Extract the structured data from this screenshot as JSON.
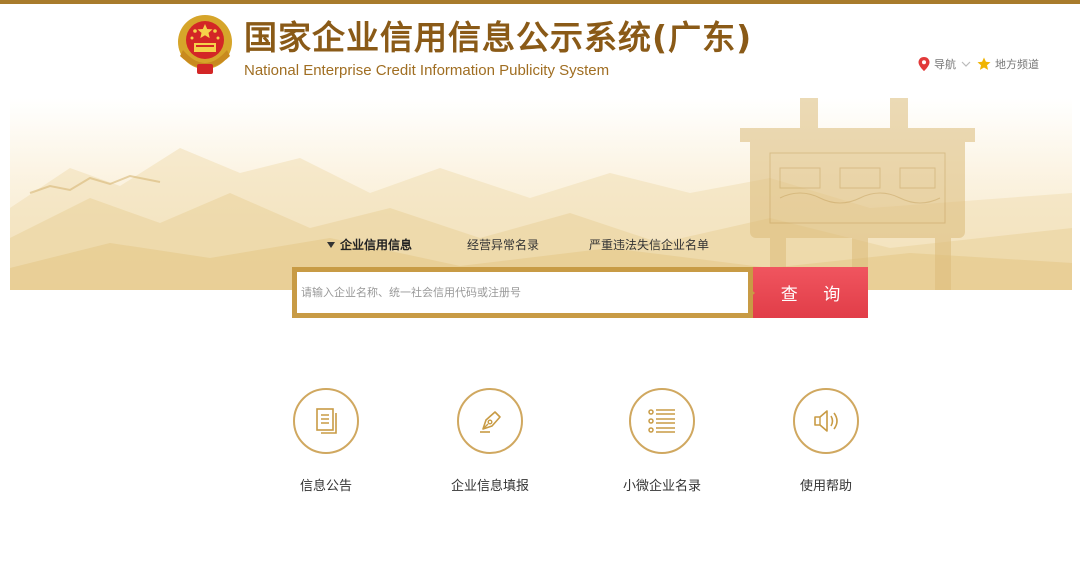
{
  "header": {
    "title": "国家企业信用信息公示系统(广东)",
    "subtitle": "National Enterprise Credit Information Publicity System",
    "emblem_icon": "national-emblem-icon",
    "nav_label": "导航",
    "local_label": "地方频道"
  },
  "search": {
    "tabs": [
      {
        "label": "企业信用信息",
        "active": true
      },
      {
        "label": "经营异常名录",
        "active": false
      },
      {
        "label": "严重违法失信企业名单",
        "active": false
      }
    ],
    "placeholder": "请输入企业名称、统一社会信用代码或注册号",
    "button_label": "查 询"
  },
  "quick_links": [
    {
      "label": "信息公告",
      "icon": "document-icon"
    },
    {
      "label": "企业信息填报",
      "icon": "pen-icon"
    },
    {
      "label": "小微企业名录",
      "icon": "list-icon"
    },
    {
      "label": "使用帮助",
      "icon": "speaker-icon"
    }
  ],
  "colors": {
    "gold": "#a87b2c",
    "title_brown": "#8a5a17",
    "search_border": "#c89b45",
    "search_button": "#e8434d",
    "icon_ring": "#d0a860"
  }
}
